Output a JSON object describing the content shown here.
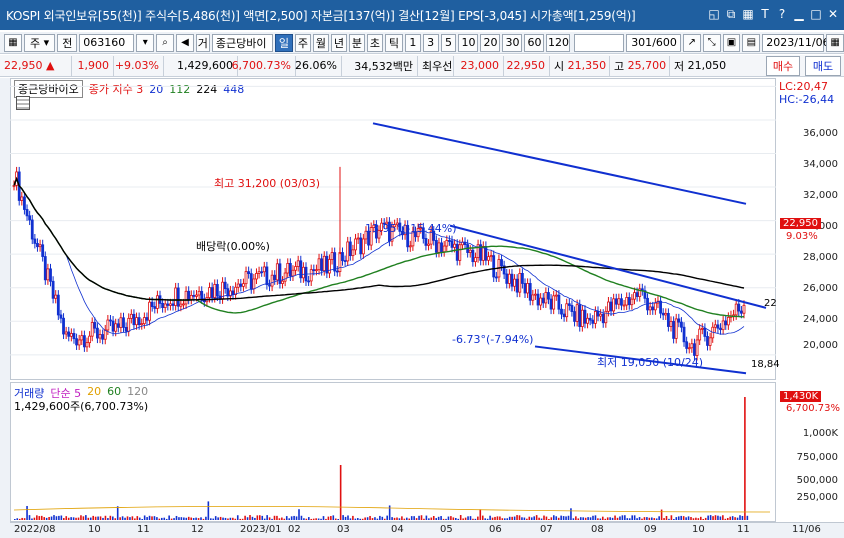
{
  "window": {
    "title": "KOSPI 외국인보유[55(천)] 주식수[5,486(천)] 액면[2,500] 자본금[137(억)] 결산[12월] EPS[-3,045] 시가총액[1,259(억)]"
  },
  "toolbar": {
    "type_label": "주",
    "jeon_label": "전",
    "code": "063160",
    "geo_label": "거",
    "stock_name": "종근당바이",
    "periods": [
      "일",
      "주",
      "월",
      "년",
      "분",
      "초",
      "틱"
    ],
    "active_period": "일",
    "intervals": [
      "1",
      "3",
      "5",
      "10",
      "20",
      "30",
      "60",
      "120"
    ],
    "count_value": "301",
    "count_total": "/600",
    "date": "2023/11/06"
  },
  "quote": {
    "price": "22,950",
    "arrow": "▲",
    "change": "1,900",
    "change_pct": "+9.03%",
    "volume": "1,429,600",
    "volume_pct": "6,700.73%",
    "turnover_pct": "26.06%",
    "amount": "34,532백만",
    "best_ask_label": "최우선",
    "best_ask": "23,000",
    "best_bid": "22,950",
    "open_label": "시",
    "open": "21,350",
    "high_label": "고",
    "high": "25,700",
    "low_label": "저",
    "low": "21,050",
    "buy_label": "매수",
    "sell_label": "매도"
  },
  "price_chart": {
    "stock_label": "종근당바이오",
    "legend_title": "종가 지수 3",
    "ma_values": [
      "20",
      "112",
      "224",
      "448"
    ],
    "lc": "LC:20,47",
    "hc": "HC:-26,44",
    "y_ticks": [
      "36,000",
      "34,000",
      "32,000",
      "30,000",
      "28,000",
      "26,000",
      "24,000",
      "22,000",
      "20,000"
    ],
    "current_tag": "22,950",
    "current_pct": "9.03%",
    "annotations": {
      "high_label": "최고 31,200 (03/03)",
      "dividend_label": "배당락(0.00%)",
      "upper_trend": "13.95°(-15.44%)",
      "lower_trend": "-6.73°(-7.94%)",
      "low_label": "최저 19,050 (10/24)",
      "right_22": "22",
      "right_18": "18,84"
    }
  },
  "volume_chart": {
    "legend_title": "거래량",
    "legend_items": [
      "단순 5",
      "20",
      "60",
      "120"
    ],
    "current_label": "1,429,600주(6,700.73%)",
    "current_tag": "1,430K",
    "current_tag_pct": "6,700.73%",
    "y_ticks": [
      "1,000K",
      "750,000",
      "500,000",
      "250,000"
    ]
  },
  "x_axis": [
    "2022/08",
    "10",
    "11",
    "12",
    "2023/01",
    "02",
    "03",
    "04",
    "05",
    "06",
    "07",
    "08",
    "09",
    "10",
    "11",
    "11/06"
  ],
  "chart_data": {
    "type": "line",
    "x": [
      "2022/08",
      "10",
      "11",
      "12",
      "2023/01",
      "02",
      "03",
      "04",
      "05",
      "06",
      "07",
      "08",
      "09",
      "10",
      "11"
    ],
    "series": [
      {
        "name": "종가",
        "values": [
          30800,
          21000,
          21500,
          23500,
          24000,
          24800,
          25200,
          27500,
          26800,
          25800,
          23500,
          22000,
          23700,
          20500,
          22950
        ]
      }
    ],
    "ylim": [
      18500,
      36500
    ],
    "colors": {
      "up": "#e01010",
      "down": "#1030d0",
      "ma20": "#1030d0",
      "ma112": "#208020",
      "ma224": "#000000",
      "trend": "#1030d0"
    }
  }
}
